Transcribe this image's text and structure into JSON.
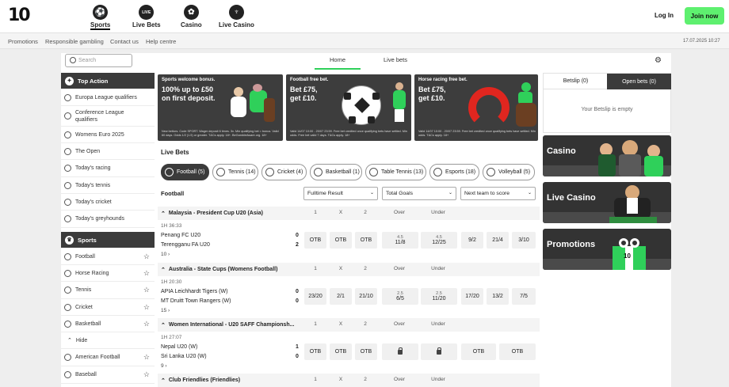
{
  "brand": {
    "logo_text": "10"
  },
  "topnav": [
    {
      "label": "Sports",
      "icon": "football-icon",
      "glyph": "⚽"
    },
    {
      "label": "Live Bets",
      "icon": "live-icon",
      "glyph": "LIVE"
    },
    {
      "label": "Casino",
      "icon": "chip-icon",
      "glyph": "✿"
    },
    {
      "label": "Live Casino",
      "icon": "dealer-icon",
      "glyph": "♆"
    }
  ],
  "auth": {
    "login": "Log In",
    "join": "Join now"
  },
  "sublinks": [
    "Promotions",
    "Responsible gambling",
    "Contact us",
    "Help centre"
  ],
  "datetime": "17.07.2025 10:27",
  "search": {
    "placeholder": "Search"
  },
  "main_tabs": [
    "Home",
    "Live bets"
  ],
  "top_action": {
    "title": "Top Action",
    "items": [
      "Europa League qualifiers",
      "Conference League qualifiers",
      "Womens Euro 2025",
      "The Open",
      "Today's racing",
      "Today's tennis",
      "Today's cricket",
      "Today's greyhounds"
    ]
  },
  "sports": {
    "title": "Sports",
    "items": [
      "Football",
      "Horse Racing",
      "Tennis",
      "Cricket",
      "Basketball"
    ],
    "hide": "Hide",
    "more_items": [
      "American Football",
      "Baseball"
    ]
  },
  "banners": [
    {
      "heading": "Sports welcome bonus.",
      "main": "100% up to £50 on first deposit.",
      "small": "New bettors. Code SPORT. Wager deposit 6 times. 3x. Min qualifying bet = bonus. Valid 60 days. Odds 1/2 (1.5) or greater. T&Cs apply. 18+. BeGambleAware.org. 18+"
    },
    {
      "heading": "Football free bet.",
      "main": "Bet £75, get £10.",
      "small": "Valid 14/07 10:00 - 20/07 23:59. Free bet credited once qualifying bets have settled. Min odds. Free bet valid 7 days. T&Cs apply. 18+"
    },
    {
      "heading": "Horse racing free bet.",
      "main": "Bet £75, get £10.",
      "small": "Valid 14/07 10:00 - 20/07 23:59. Free bet credited once qualifying bets have settled. Min odds. T&Cs apply. 18+"
    }
  ],
  "live_bets": {
    "title": "Live Bets",
    "filters": [
      "Football (5)",
      "Tennis (14)",
      "Cricket (4)",
      "Basketball (1)",
      "Table Tennis (13)",
      "Esports (18)",
      "Volleyball (5)"
    ],
    "sport_label": "Football",
    "dropdowns": [
      "Fulltime Result",
      "Total Goals",
      "Next team to score"
    ],
    "col_headers": [
      "1",
      "X",
      "2",
      "Over",
      "Under"
    ],
    "matches": [
      {
        "competition": "Malaysia - President Cup U20 (Asia)",
        "time": "1H 36:33",
        "home": "Penang FC U20",
        "away": "Terengganu FA U20",
        "home_score": "0",
        "away_score": "2",
        "more": "10 ›",
        "odds": [
          {
            "v": "OTB"
          },
          {
            "v": "OTB"
          },
          {
            "v": "OTB"
          },
          {
            "line": "4.5",
            "v": "11/8"
          },
          {
            "line": "4.5",
            "v": "12/25"
          },
          {
            "v": "9/2"
          },
          {
            "v": "21/4"
          },
          {
            "v": "3/10"
          }
        ]
      },
      {
        "competition": "Australia - State Cups (Womens Football)",
        "time": "1H 20:30",
        "home": "APIA Leichhardt Tigers (W)",
        "away": "MT Druitt Town Rangers (W)",
        "home_score": "0",
        "away_score": "0",
        "more": "15 ›",
        "odds": [
          {
            "v": "23/20"
          },
          {
            "v": "2/1"
          },
          {
            "v": "21/10"
          },
          {
            "line": "2.5",
            "v": "6/5"
          },
          {
            "line": "2.5",
            "v": "11/20"
          },
          {
            "v": "17/20"
          },
          {
            "v": "13/2"
          },
          {
            "v": "7/5"
          }
        ]
      },
      {
        "competition": "Women International - U20 SAFF Championsh...",
        "time": "1H 27:07",
        "home": "Nepal U20 (W)",
        "away": "Sri Lanka U20 (W)",
        "home_score": "1",
        "away_score": "0",
        "more": "9 ›",
        "odds": [
          {
            "v": "OTB"
          },
          {
            "v": "OTB"
          },
          {
            "v": "OTB"
          },
          {
            "lock": true
          },
          {
            "lock": true
          },
          {
            "v": "OTB"
          },
          {
            "v": "OTB"
          }
        ]
      },
      {
        "competition": "Club Friendlies (Friendlies)"
      }
    ]
  },
  "betslip": {
    "tab1": "Betslip (0)",
    "tab2": "Open bets (0)",
    "empty": "Your Betslip is empty"
  },
  "promos": [
    "Casino",
    "Live Casino",
    "Promotions"
  ],
  "colors": {
    "accent": "#5ef06f",
    "dark": "#3b3b3b",
    "underline": "#2fd05a"
  }
}
